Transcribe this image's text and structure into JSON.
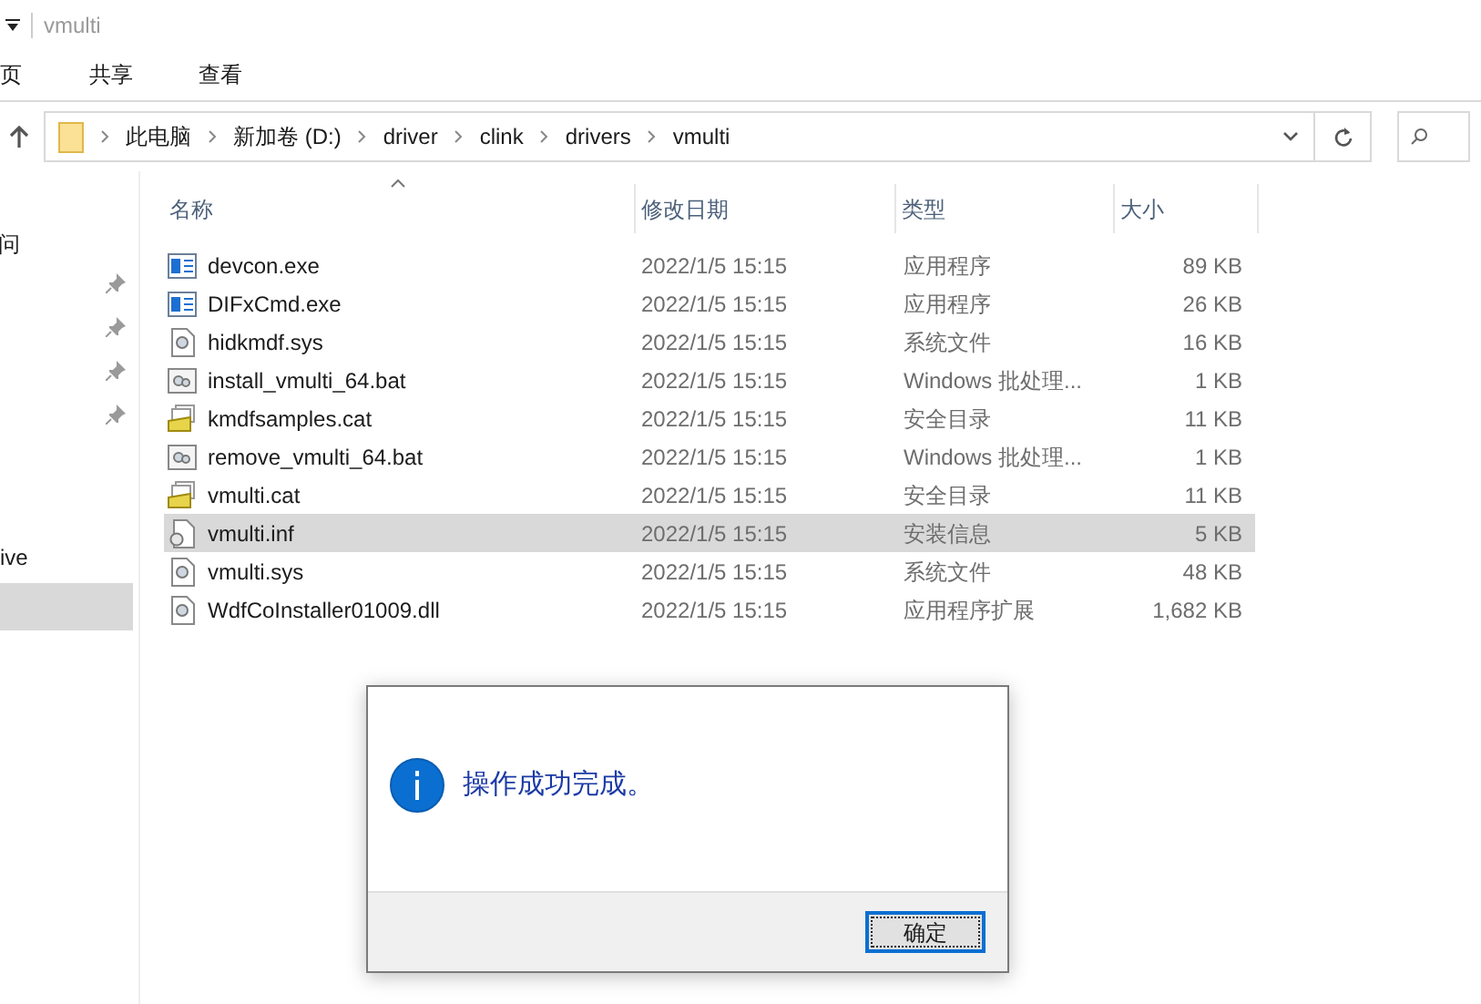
{
  "window": {
    "title": "vmulti"
  },
  "ribbon_tabs": [
    {
      "label": "页"
    },
    {
      "label": "共享"
    },
    {
      "label": "查看"
    }
  ],
  "address_bar": {
    "segments": [
      "此电脑",
      "新加卷 (D:)",
      "driver",
      "clink",
      "drivers",
      "vmulti"
    ]
  },
  "nav_pane": {
    "items": [
      {
        "label": "问",
        "selected": false
      },
      {
        "label": "ive",
        "selected": false
      },
      {
        "selected": true
      }
    ]
  },
  "file_list": {
    "columns": [
      "名称",
      "修改日期",
      "类型",
      "大小"
    ],
    "rows": [
      {
        "name": "devcon.exe",
        "kind": "exe",
        "modified": "2022/1/5 15:15",
        "type": "应用程序",
        "size": "89 KB",
        "selected": false
      },
      {
        "name": "DIFxCmd.exe",
        "kind": "exe",
        "modified": "2022/1/5 15:15",
        "type": "应用程序",
        "size": "26 KB",
        "selected": false
      },
      {
        "name": "hidkmdf.sys",
        "kind": "sys",
        "modified": "2022/1/5 15:15",
        "type": "系统文件",
        "size": "16 KB",
        "selected": false
      },
      {
        "name": "install_vmulti_64.bat",
        "kind": "bat",
        "modified": "2022/1/5 15:15",
        "type": "Windows 批处理...",
        "size": "1 KB",
        "selected": false
      },
      {
        "name": "kmdfsamples.cat",
        "kind": "cat",
        "modified": "2022/1/5 15:15",
        "type": "安全目录",
        "size": "11 KB",
        "selected": false
      },
      {
        "name": "remove_vmulti_64.bat",
        "kind": "bat",
        "modified": "2022/1/5 15:15",
        "type": "Windows 批处理...",
        "size": "1 KB",
        "selected": false
      },
      {
        "name": "vmulti.cat",
        "kind": "cat",
        "modified": "2022/1/5 15:15",
        "type": "安全目录",
        "size": "11 KB",
        "selected": false
      },
      {
        "name": "vmulti.inf",
        "kind": "inf",
        "modified": "2022/1/5 15:15",
        "type": "安装信息",
        "size": "5 KB",
        "selected": true
      },
      {
        "name": "vmulti.sys",
        "kind": "sys",
        "modified": "2022/1/5 15:15",
        "type": "系统文件",
        "size": "48 KB",
        "selected": false
      },
      {
        "name": "WdfCoInstaller01009.dll",
        "kind": "sys",
        "modified": "2022/1/5 15:15",
        "type": "应用程序扩展",
        "size": "1,682 KB",
        "selected": false
      }
    ]
  },
  "dialog": {
    "message": "操作成功完成。",
    "button": "确定"
  }
}
